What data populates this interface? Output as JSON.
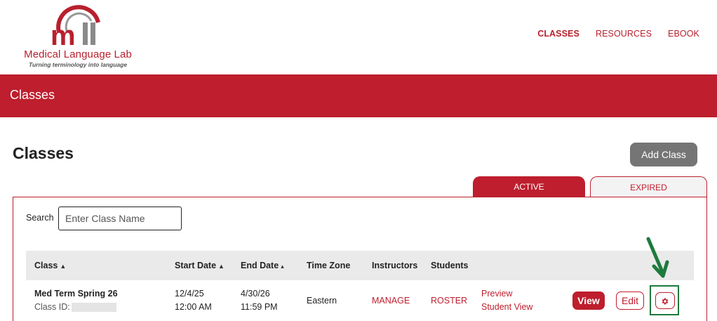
{
  "logo": {
    "mark_text": "mll",
    "name": "Medical Language Lab",
    "tagline": "Turning terminology into language"
  },
  "nav": {
    "items": [
      {
        "label": "CLASSES",
        "active": true
      },
      {
        "label": "RESOURCES",
        "active": false
      },
      {
        "label": "EBOOK",
        "active": false
      }
    ]
  },
  "band": {
    "title": "Classes"
  },
  "page": {
    "title": "Classes",
    "add_button": "Add Class"
  },
  "tabs": {
    "active": "ACTIVE",
    "expired": "EXPIRED"
  },
  "search": {
    "label": "Search",
    "placeholder": "Enter Class Name",
    "value": ""
  },
  "table": {
    "headers": {
      "class": "Class",
      "start_date": "Start Date",
      "end_date": "End Date",
      "time_zone": "Time Zone",
      "instructors": "Instructors",
      "students": "Students"
    },
    "rows": [
      {
        "name": "Med Term Spring 26",
        "id_label": "Class ID:",
        "start_date": "12/4/25",
        "start_time": "12:00 AM",
        "end_date": "4/30/26",
        "end_time": "11:59 PM",
        "time_zone": "Eastern",
        "instructors_link": "MANAGE",
        "students_link": "ROSTER",
        "preview_line1": "Preview",
        "preview_line2": "Student View",
        "view_label": "View",
        "edit_label": "Edit"
      }
    ]
  },
  "colors": {
    "brand_red": "#be1e2d",
    "annotation_green": "#1e7a3c",
    "add_button_gray": "#757575"
  },
  "icons": {
    "sort_both": "sort-both-icon",
    "sort_up": "sort-up-icon",
    "settings": "gear-icon",
    "annotation": "arrow-down-icon"
  }
}
